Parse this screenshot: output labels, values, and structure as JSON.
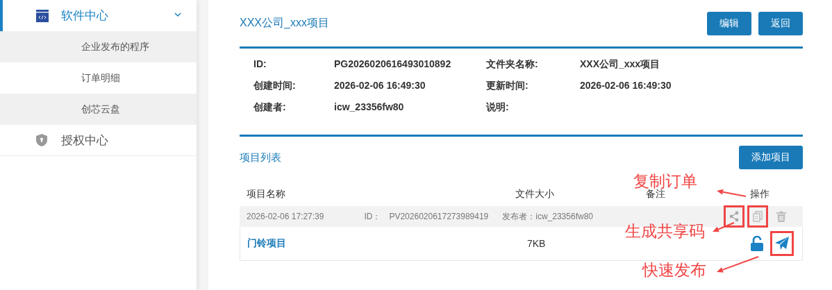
{
  "sidebar": {
    "menus": [
      {
        "label": "软件中心",
        "kind": "code",
        "active": true,
        "expanded": true,
        "children": [
          {
            "label": "企业发布的程序",
            "shaded": true
          },
          {
            "label": "订单明细",
            "shaded": false
          },
          {
            "label": "创芯云盘",
            "shaded": true
          }
        ]
      },
      {
        "label": "授权中心",
        "kind": "shield",
        "active": false
      }
    ]
  },
  "detail": {
    "title": "XXX公司_xxx项目",
    "buttons": [
      "编辑",
      "返回"
    ],
    "fields": [
      {
        "label": "ID:",
        "value": "PG2026020616493010892"
      },
      {
        "label": "文件夹名称:",
        "value": "XXX公司_xxx项目"
      },
      {
        "label": "创建时间:",
        "value": "2026-02-06 16:49:30"
      },
      {
        "label": "更新时间:",
        "value": "2026-02-06 16:49:30"
      },
      {
        "label": "创建者:",
        "value": "icw_23356fw80"
      },
      {
        "label": "说明:"
      }
    ]
  },
  "projects": {
    "title": "项目列表",
    "add_button": "添加项目",
    "columns": [
      "项目名称",
      "文件大小",
      "备注",
      "操作"
    ],
    "rows": [
      {
        "date": "2026-02-06 17:27:39",
        "id_label": "ID：",
        "id": "PV2026020617273989419",
        "publisher": "发布者：icw_23356fw80",
        "name": "门铃项目",
        "size": "7KB",
        "meta_actions": [
          {
            "kind": "share",
            "highlighted": true
          },
          {
            "kind": "copy",
            "highlighted": true
          },
          {
            "kind": "trash",
            "highlighted": false
          }
        ],
        "actions": [
          {
            "kind": "unlock",
            "highlighted": false
          },
          {
            "kind": "send",
            "highlighted": true
          }
        ]
      }
    ]
  },
  "annotations": [
    {
      "text": "复制订单"
    },
    {
      "text": "生成共享码"
    },
    {
      "text": "快速发布"
    }
  ]
}
